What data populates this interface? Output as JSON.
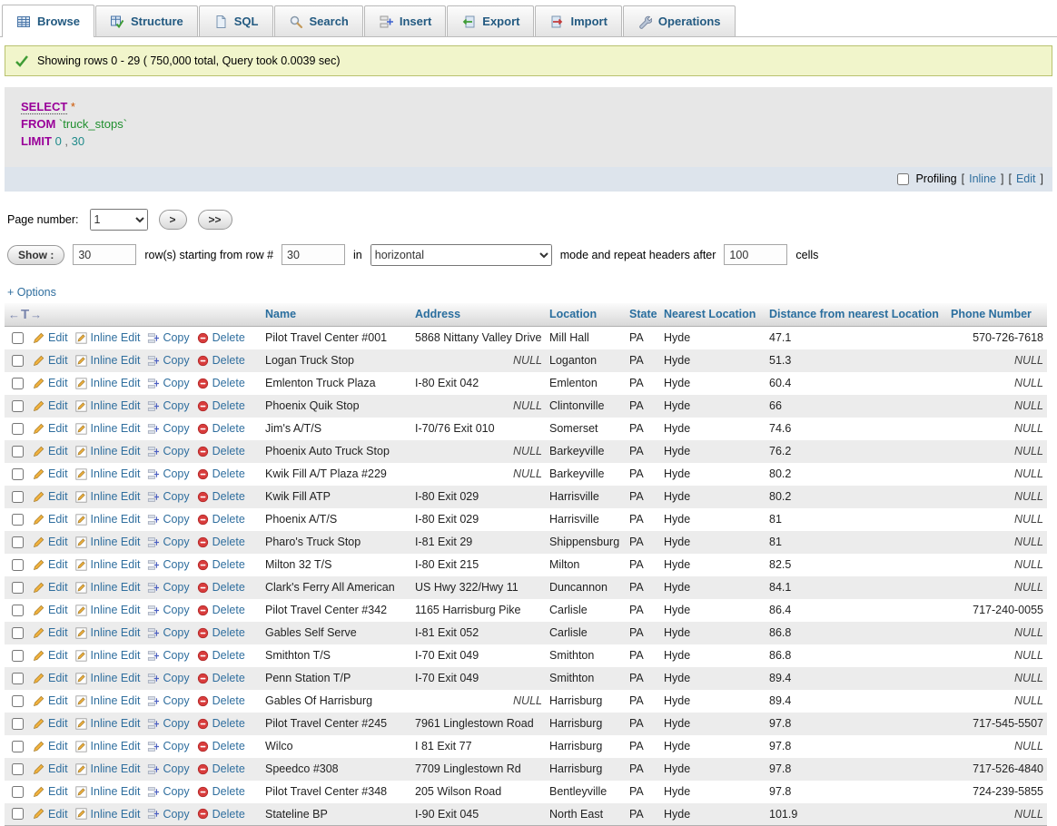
{
  "tabs": [
    {
      "label": "Browse"
    },
    {
      "label": "Structure"
    },
    {
      "label": "SQL"
    },
    {
      "label": "Search"
    },
    {
      "label": "Insert"
    },
    {
      "label": "Export"
    },
    {
      "label": "Import"
    },
    {
      "label": "Operations"
    }
  ],
  "message": {
    "text": "Showing rows 0 - 29 ( 750,000 total, Query took 0.0039 sec)"
  },
  "sql": {
    "select_kw": "SELECT",
    "select_arg": "*",
    "from_kw": "FROM",
    "table_ref": "`truck_stops`",
    "limit_kw": "LIMIT",
    "limit_num1": "0",
    "limit_comma": ",",
    "limit_num2": "30"
  },
  "profiling": {
    "label": "Profiling",
    "open1": "[",
    "inline_label": "Inline",
    "close1": "]",
    "open2": "[",
    "edit_label": "Edit",
    "close2": "]"
  },
  "pager": {
    "label": "Page number:",
    "page_value": "1",
    "next_label": ">",
    "last_label": ">>"
  },
  "showbar": {
    "button_label": "Show :",
    "rows_value": "30",
    "text1": "row(s) starting from row #",
    "start_value": "30",
    "text2": "in",
    "mode_value": "horizontal",
    "text3": "mode and repeat headers after",
    "headers_value": "100",
    "text4": "cells"
  },
  "options_link": "+ Options",
  "table": {
    "marker": {
      "left": "←",
      "tee": "T",
      "right": "→"
    },
    "columns": [
      "Name",
      "Address",
      "Location",
      "State",
      "Nearest Location",
      "Distance from nearest Location",
      "Phone Number"
    ],
    "action_labels": {
      "edit": "Edit",
      "inline_edit": "Inline Edit",
      "copy": "Copy",
      "delete": "Delete"
    },
    "rows": [
      {
        "name": "Pilot Travel Center #001",
        "address": "5868 Nittany Valley Drive",
        "location": "Mill Hall",
        "state": "PA",
        "nearest_location": "Hyde",
        "distance": "47.1",
        "phone": "570-726-7618"
      },
      {
        "name": "Logan Truck Stop",
        "address": "NULL",
        "location": "Loganton",
        "state": "PA",
        "nearest_location": "Hyde",
        "distance": "51.3",
        "phone": "NULL"
      },
      {
        "name": "Emlenton Truck Plaza",
        "address": "I-80 Exit 042",
        "location": "Emlenton",
        "state": "PA",
        "nearest_location": "Hyde",
        "distance": "60.4",
        "phone": "NULL"
      },
      {
        "name": "Phoenix Quik Stop",
        "address": "NULL",
        "location": "Clintonville",
        "state": "PA",
        "nearest_location": "Hyde",
        "distance": "66",
        "phone": "NULL"
      },
      {
        "name": "Jim's A/T/S",
        "address": "I-70/76 Exit 010",
        "location": "Somerset",
        "state": "PA",
        "nearest_location": "Hyde",
        "distance": "74.6",
        "phone": "NULL"
      },
      {
        "name": "Phoenix Auto Truck Stop",
        "address": "NULL",
        "location": "Barkeyville",
        "state": "PA",
        "nearest_location": "Hyde",
        "distance": "76.2",
        "phone": "NULL"
      },
      {
        "name": "Kwik Fill A/T Plaza #229",
        "address": "NULL",
        "location": "Barkeyville",
        "state": "PA",
        "nearest_location": "Hyde",
        "distance": "80.2",
        "phone": "NULL"
      },
      {
        "name": "Kwik Fill ATP",
        "address": "I-80 Exit 029",
        "location": "Harrisville",
        "state": "PA",
        "nearest_location": "Hyde",
        "distance": "80.2",
        "phone": "NULL"
      },
      {
        "name": "Phoenix A/T/S",
        "address": "I-80 Exit 029",
        "location": "Harrisville",
        "state": "PA",
        "nearest_location": "Hyde",
        "distance": "81",
        "phone": "NULL"
      },
      {
        "name": "Pharo's Truck Stop",
        "address": "I-81 Exit 29",
        "location": "Shippensburg",
        "state": "PA",
        "nearest_location": "Hyde",
        "distance": "81",
        "phone": "NULL"
      },
      {
        "name": "Milton 32 T/S",
        "address": "I-80 Exit 215",
        "location": "Milton",
        "state": "PA",
        "nearest_location": "Hyde",
        "distance": "82.5",
        "phone": "NULL"
      },
      {
        "name": "Clark's Ferry All American",
        "address": "US Hwy 322/Hwy 11",
        "location": "Duncannon",
        "state": "PA",
        "nearest_location": "Hyde",
        "distance": "84.1",
        "phone": "NULL"
      },
      {
        "name": "Pilot Travel Center #342",
        "address": "1165 Harrisburg Pike",
        "location": "Carlisle",
        "state": "PA",
        "nearest_location": "Hyde",
        "distance": "86.4",
        "phone": "717-240-0055"
      },
      {
        "name": "Gables Self Serve",
        "address": "I-81 Exit 052",
        "location": "Carlisle",
        "state": "PA",
        "nearest_location": "Hyde",
        "distance": "86.8",
        "phone": "NULL"
      },
      {
        "name": "Smithton T/S",
        "address": "I-70 Exit 049",
        "location": "Smithton",
        "state": "PA",
        "nearest_location": "Hyde",
        "distance": "86.8",
        "phone": "NULL"
      },
      {
        "name": "Penn Station T/P",
        "address": "I-70 Exit 049",
        "location": "Smithton",
        "state": "PA",
        "nearest_location": "Hyde",
        "distance": "89.4",
        "phone": "NULL"
      },
      {
        "name": "Gables Of Harrisburg",
        "address": "NULL",
        "location": "Harrisburg",
        "state": "PA",
        "nearest_location": "Hyde",
        "distance": "89.4",
        "phone": "NULL"
      },
      {
        "name": "Pilot Travel Center #245",
        "address": "7961 Linglestown Road",
        "location": "Harrisburg",
        "state": "PA",
        "nearest_location": "Hyde",
        "distance": "97.8",
        "phone": "717-545-5507"
      },
      {
        "name": "Wilco",
        "address": "I 81 Exit 77",
        "location": "Harrisburg",
        "state": "PA",
        "nearest_location": "Hyde",
        "distance": "97.8",
        "phone": "NULL"
      },
      {
        "name": "Speedco #308",
        "address": "7709 Linglestown Rd",
        "location": "Harrisburg",
        "state": "PA",
        "nearest_location": "Hyde",
        "distance": "97.8",
        "phone": "717-526-4840"
      },
      {
        "name": "Pilot Travel Center #348",
        "address": "205 Wilson Road",
        "location": "Bentleyville",
        "state": "PA",
        "nearest_location": "Hyde",
        "distance": "97.8",
        "phone": "724-239-5855"
      },
      {
        "name": "Stateline BP",
        "address": "I-90 Exit 045",
        "location": "North East",
        "state": "PA",
        "nearest_location": "Hyde",
        "distance": "101.9",
        "phone": "NULL"
      }
    ]
  }
}
